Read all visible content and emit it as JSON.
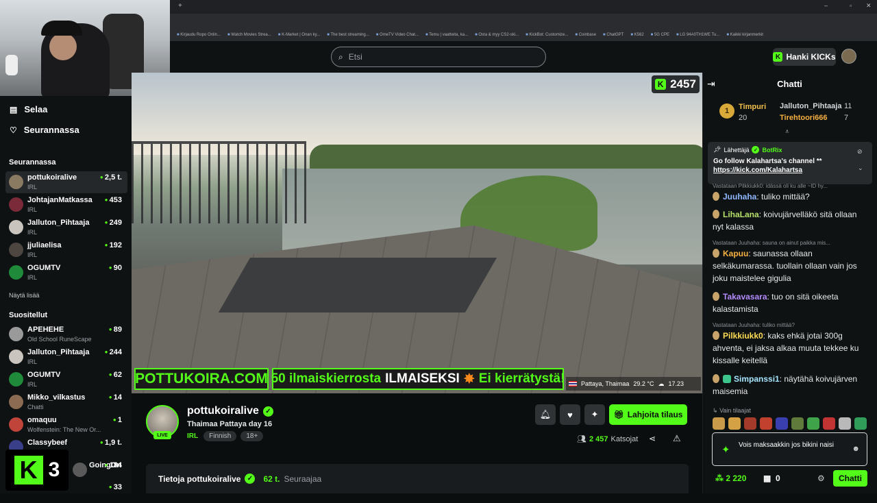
{
  "browser": {
    "bookmarks": [
      "Kirjaudu Ropo Onlin...",
      "Watch Movies Strea...",
      "K-Market | Onan ky...",
      "The best streaming...",
      "OmeTV Video Chat...",
      "Temu | vaatteita, ka...",
      "Osta & myy CS2-ski...",
      "KickBot: Customize...",
      "Coinbase",
      "ChatGPT",
      "K562",
      "5G CPE",
      "LG 94A0TH1WE Tu...",
      "Kaikki kirjanmerkit"
    ]
  },
  "header": {
    "search_placeholder": "Etsi",
    "get_kicks_label": "Hanki KICKs"
  },
  "sidebar": {
    "browse_label": "Selaa",
    "following_label": "Seurannassa",
    "following_section_title": "Seurannassa",
    "following_channels": [
      {
        "name": "pottukoiralive",
        "category": "IRL",
        "viewers": "2,5 t."
      },
      {
        "name": "JohtajanMatkassa",
        "category": "IRL",
        "viewers": "453"
      },
      {
        "name": "Jalluton_Pihtaaja",
        "category": "IRL",
        "viewers": "249"
      },
      {
        "name": "jjuliaelisa",
        "category": "IRL",
        "viewers": "192"
      },
      {
        "name": "OGUMTV",
        "category": "IRL",
        "viewers": "90"
      }
    ],
    "show_more_label": "Näytä lisää",
    "recommended_section_title": "Suositellut",
    "recommended_channels": [
      {
        "name": "APEHEHE",
        "category": "Old School RuneScape",
        "viewers": "89"
      },
      {
        "name": "Jalluton_Pihtaaja",
        "category": "IRL",
        "viewers": "244"
      },
      {
        "name": "OGUMTV",
        "category": "IRL",
        "viewers": "62"
      },
      {
        "name": "Mikko_vilkastus",
        "category": "Chatti",
        "viewers": "14"
      },
      {
        "name": "omaquu",
        "category": "Wolfenstein: The New Or...",
        "viewers": "1"
      },
      {
        "name": "Classybeef",
        "category": "",
        "viewers": "1,9 t."
      },
      {
        "name": "GoingOn",
        "category": "",
        "viewers": "184"
      },
      {
        "name": "",
        "category": "",
        "viewers": "33"
      }
    ],
    "overlay_number": "3"
  },
  "video": {
    "viewer_count": "2457",
    "banner_site": "POTTUKOIRA.COM",
    "banner_offer_green": "50 ilmaiskierrosta",
    "banner_offer_white": "ILMAISEKSI",
    "banner_offer_tail": "Ei kierrätystä!",
    "location": "Pattaya, Thaimaa",
    "temperature": "29.2 °C",
    "time": "17.23"
  },
  "stream": {
    "live_label": "LIVE",
    "streamer": "pottukoiralive",
    "title": "Thaimaa Pattaya day 16",
    "category": "IRL",
    "tags": [
      "Finnish",
      "18+"
    ],
    "gift_label": "Lahjoita tilaus",
    "viewers": "2 457",
    "viewers_label": "Katsojat",
    "about_label": "Tietoja pottukoiralive",
    "followers": "62 t.",
    "followers_label": "Seuraajaa"
  },
  "chat": {
    "title": "Chatti",
    "leaderboard": [
      {
        "rank": "1",
        "name": "Timpuri",
        "value": "20"
      },
      {
        "name": "Jalluton_Pihtaaja",
        "value": "11"
      },
      {
        "name": "Tirehtoori666",
        "value": "7"
      }
    ],
    "pinned": {
      "sender_label": "Lähettäjä",
      "sender": "BotRix",
      "message": "Go follow Kalahartsa's channel **",
      "link": "https://kick.com/Kalahartsa"
    },
    "reply_0": "Vastataan Pilkkiukk0: idässä oli ku alle ~ID hy...",
    "messages": [
      {
        "user": "Juuhaha",
        "text": "tuliko mittää?"
      },
      {
        "user": "LihaLana",
        "text": "koivujärvelläkö sitä ollaan nyt kalassa"
      },
      {
        "reply": "Vastataan Juuhaha: sauna on ainut paikka mis...",
        "user": "Kapuu",
        "text": "saunassa ollaan selkäkumarassa. tuollain ollaan vain jos joku maistelee gigulia"
      },
      {
        "user": "Takavasara",
        "text": "tuo on sitä oikeeta kalastamista"
      },
      {
        "reply": "Vastataan Juuhaha: tuliko mittää?",
        "user": "Pilkkiukk0",
        "text": "kaks ehkä jotai 300g ahventa, ei jaksa alkaa muuta tekkee ku kissalle keitellä"
      },
      {
        "user": "Simpanssi1",
        "text": "näytähä koivujärven maisemia"
      }
    ],
    "sub_only_label": "Vain tilaajat",
    "input_text": "Vois maksaakkin jos bikini naisi",
    "points": "2 220",
    "kicks": "0",
    "send_label": "Chatti"
  }
}
